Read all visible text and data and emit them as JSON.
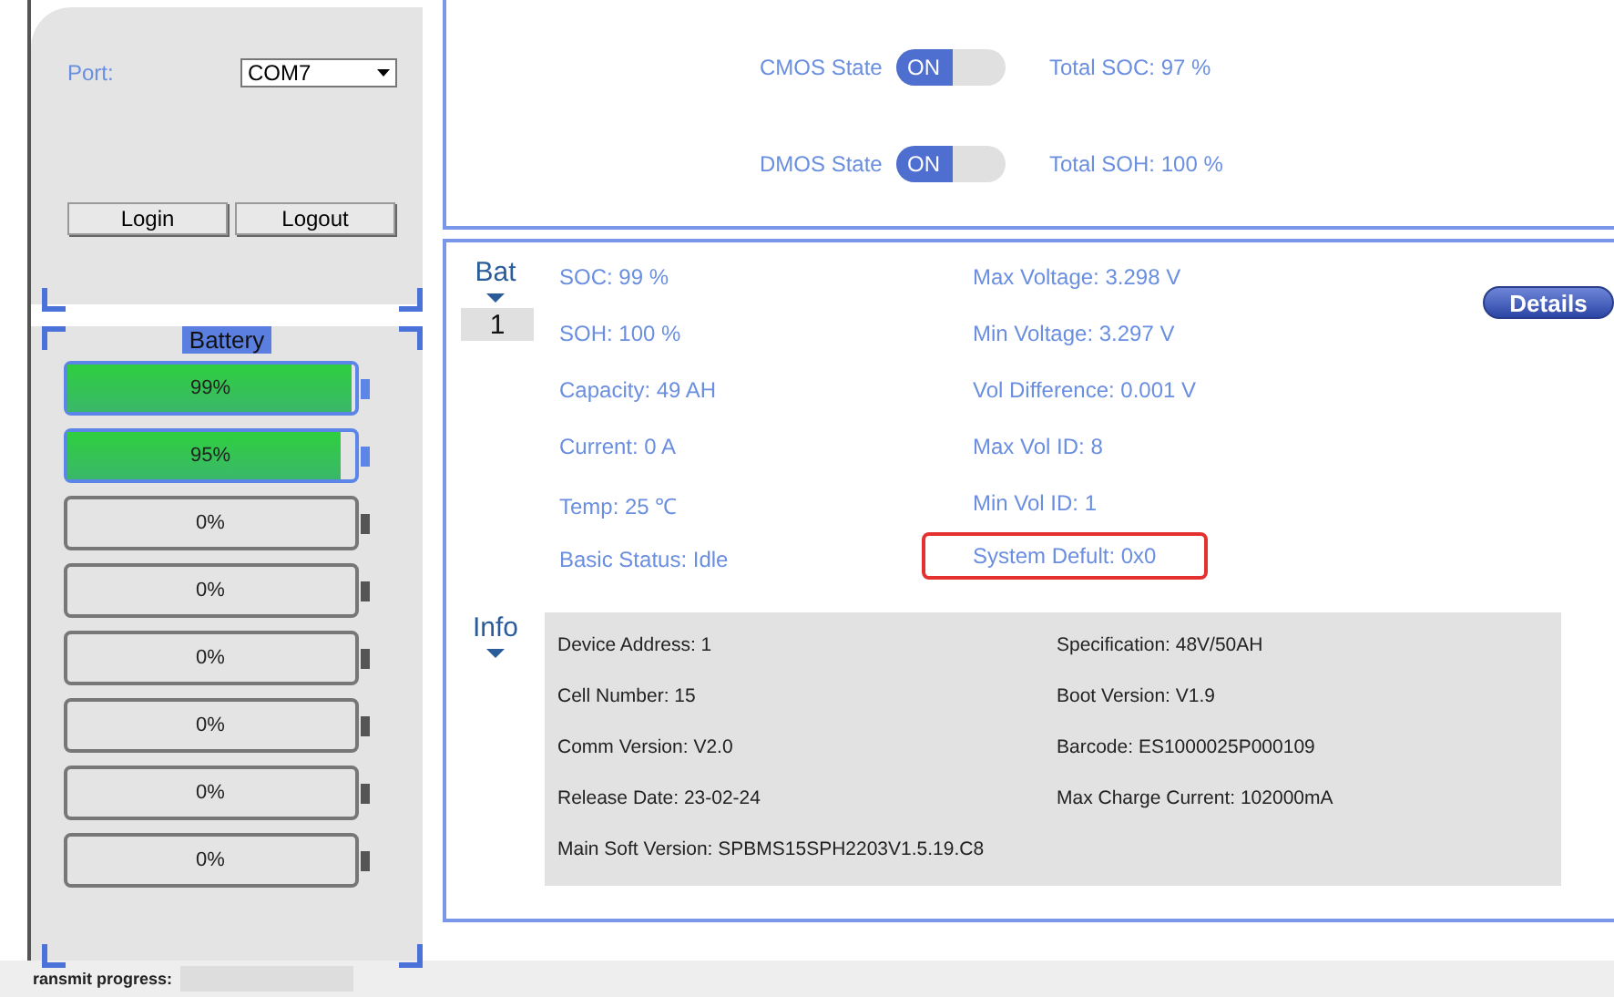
{
  "connection": {
    "port_label": "Port:",
    "port_value": "COM7",
    "buttons": [
      "Login",
      "Logout"
    ]
  },
  "battery_panel": {
    "title": "Battery",
    "batteries": [
      {
        "label": "99%",
        "level": 0.99
      },
      {
        "label": "95%",
        "level": 0.95
      },
      {
        "label": "0%",
        "level": 0
      },
      {
        "label": "0%",
        "level": 0
      },
      {
        "label": "0%",
        "level": 0
      },
      {
        "label": "0%",
        "level": 0
      },
      {
        "label": "0%",
        "level": 0
      },
      {
        "label": "0%",
        "level": 0
      }
    ]
  },
  "states": [
    {
      "label": "CMOS State",
      "toggle": "ON",
      "on": true,
      "total": "Total SOC: 97 %"
    },
    {
      "label": "DMOS State",
      "toggle": "ON",
      "on": true,
      "total": "Total SOH: 100 %"
    }
  ],
  "bat": {
    "title": "Bat",
    "selector": "1",
    "details_button": "Details",
    "fields": [
      {
        "text": "SOC: 99 %",
        "highlighted": false
      },
      {
        "text": "Max Voltage: 3.298 V",
        "highlighted": false
      },
      {
        "text": "SOH: 100 %",
        "highlighted": false
      },
      {
        "text": "Min Voltage: 3.297 V",
        "highlighted": false
      },
      {
        "text": "Capacity: 49 AH",
        "highlighted": false
      },
      {
        "text": "Vol Difference: 0.001 V",
        "highlighted": false
      },
      {
        "text": "Current: 0 A",
        "highlighted": false
      },
      {
        "text": "Max Vol ID: 8",
        "highlighted": false
      },
      {
        "text": "Temp: 25 ℃",
        "highlighted": false
      },
      {
        "text": "Min Vol ID: 1",
        "highlighted": false
      },
      {
        "text": "Basic Status: Idle",
        "highlighted": false
      },
      {
        "text": "System Defult: 0x0",
        "highlighted": true
      }
    ]
  },
  "info": {
    "title": "Info",
    "fields": [
      "Device Address: 1",
      "Specification: 48V/50AH",
      "Cell Number: 15",
      "Boot Version: V1.9",
      "Comm Version: V2.0",
      "Barcode: ES1000025P000109",
      "Release Date: 23-02-24",
      "Max Charge Current: 102000mA",
      "Main Soft Version: SPBMS15SPH2203V1.5.19.C8"
    ]
  },
  "status_bar": {
    "label": "ransmit progress:"
  }
}
